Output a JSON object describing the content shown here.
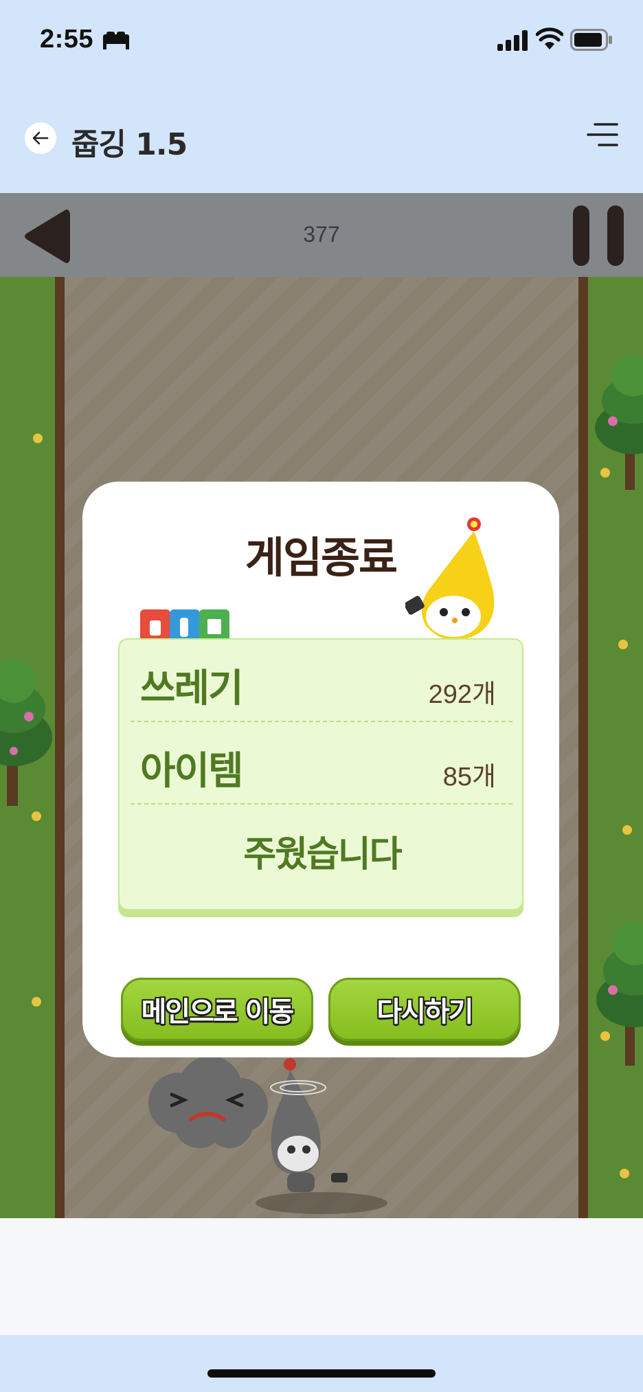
{
  "status_bar": {
    "time": "2:55"
  },
  "header": {
    "title": "줍깅 1.5"
  },
  "game_bar": {
    "score": "377"
  },
  "result": {
    "title": "게임종료",
    "rows": [
      {
        "label": "쓰레기",
        "value": "292개"
      },
      {
        "label": "아이템",
        "value": "85개"
      }
    ],
    "footer": "주웠습니다",
    "buttons": {
      "main": "메인으로 이동",
      "retry": "다시하기"
    }
  },
  "colors": {
    "background": "#d3e5fb",
    "game_bar": "#848789",
    "grass": "#5b8a34",
    "road": "#8e8474",
    "accent_green": "#4f7a22",
    "button_green": "#95c92f"
  }
}
